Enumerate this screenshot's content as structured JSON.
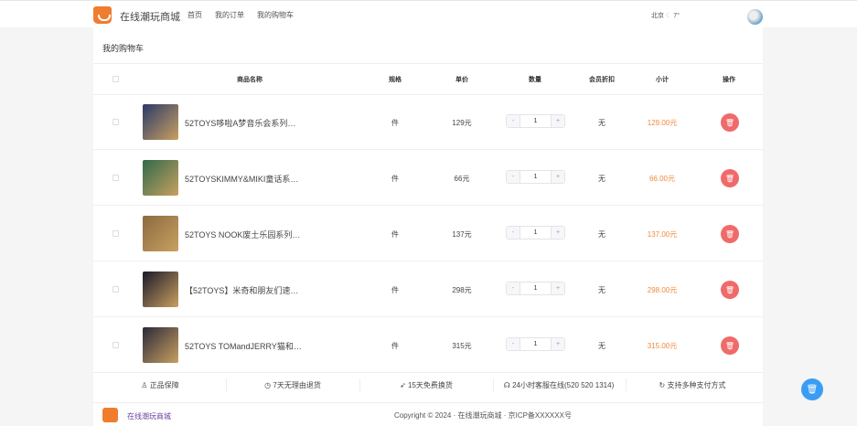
{
  "header": {
    "brand": "在线潮玩商城",
    "nav": [
      "首页",
      "我的订单",
      "我的购物车"
    ],
    "city": "北京",
    "weather_icon": "moon-icon",
    "temp": "7°"
  },
  "page_title": "我的购物车",
  "columns": [
    "商品名称",
    "规格",
    "单价",
    "数量",
    "会员折扣",
    "小计",
    "操作"
  ],
  "items": [
    {
      "name": "52TOYS哆啦A梦音乐会系列…",
      "spec": "件",
      "price": "129元",
      "qty": "1",
      "discount": "无",
      "subtotal": "129.00元",
      "thumb": "#2a3a6a"
    },
    {
      "name": "52TOYSKIMMY&MIKI童话系…",
      "spec": "件",
      "price": "66元",
      "qty": "1",
      "discount": "无",
      "subtotal": "66.00元",
      "thumb": "#2f6a4a"
    },
    {
      "name": "52TOYS NOOK废土乐园系列…",
      "spec": "件",
      "price": "137元",
      "qty": "1",
      "discount": "无",
      "subtotal": "137.00元",
      "thumb": "#8a6a40"
    },
    {
      "name": "【52TOYS】米奇和朋友们速…",
      "spec": "件",
      "price": "298元",
      "qty": "1",
      "discount": "无",
      "subtotal": "298.00元",
      "thumb": "#1a1a2a"
    },
    {
      "name": "52TOYS TOMandJERRY猫和…",
      "spec": "件",
      "price": "315元",
      "qty": "1",
      "discount": "无",
      "subtotal": "315.00元",
      "thumb": "#2a2a3a"
    }
  ],
  "stepper": {
    "minus": "-",
    "plus": "+"
  },
  "features": [
    "正品保障",
    "7天无理由退货",
    "15天免费换货",
    "24小时客服在线(520 520 1314)",
    "支持多种支付方式"
  ],
  "footer": {
    "brand": "在线潮玩商城",
    "copyright": "Copyright © 2024 · 在线潮玩商城 · 京ICP备XXXXXX号"
  },
  "colors": {
    "accent": "#f07d2e",
    "subtotal": "#f08a3c",
    "delete": "#f06a6a",
    "fab": "#3b9cf5"
  }
}
